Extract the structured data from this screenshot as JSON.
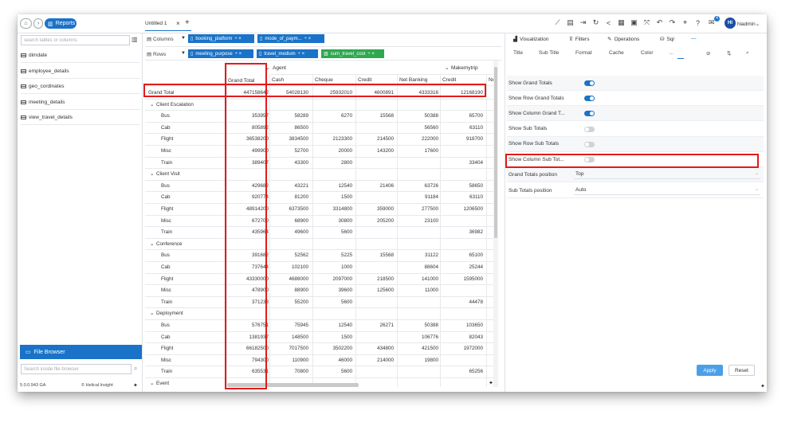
{
  "topbar": {
    "home_icon": "home-icon",
    "reports_label": "Reports",
    "tab_label": "Untitled 1",
    "tab_close": "×",
    "tab_add": "+",
    "bell_count": "4",
    "avatar": "HI",
    "user": "hiadmin"
  },
  "left": {
    "search_placeholder": "search tables or columns",
    "tables": [
      "dimdate",
      "employee_details",
      "geo_cordinates",
      "meeting_details",
      "view_travel_details"
    ],
    "file_browser": "File Browser",
    "file_search_placeholder": "Search inside file browser",
    "version": "5.0.0.943 GA",
    "brand": "Helical Insight"
  },
  "zones": {
    "columns_label": "Columns",
    "rows_label": "Rows",
    "columns": [
      "booking_platform",
      "mode_of_paym..."
    ],
    "rows": [
      "meeting_purpose",
      "travel_medium"
    ],
    "measure": "sum_travel_cost"
  },
  "pivot": {
    "group1": "Agent",
    "group2": "Makemytrip",
    "grand_total_header": "Grand Total",
    "columns": [
      "Cash",
      "Cheque",
      "Credit",
      "Net Banking",
      "Credit",
      "Ne"
    ],
    "grand_total_row": {
      "label": "Grand Total",
      "total": "447158642",
      "values": [
        "54028130",
        "25932010",
        "4600891",
        "4333316",
        "12168190",
        ""
      ]
    },
    "groups": [
      {
        "name": "Client Escalation",
        "rows": [
          {
            "label": "Bus",
            "total": "353957",
            "values": [
              "58289",
              "6270",
              "15568",
              "50388",
              "65700",
              ""
            ]
          },
          {
            "label": "Cab",
            "total": "805892",
            "values": [
              "86500",
              "",
              "",
              "56560",
              "63110",
              ""
            ]
          },
          {
            "label": "Flight",
            "total": "36538200",
            "values": [
              "3834500",
              "2123300",
              "214500",
              "222000",
              "918700",
              ""
            ]
          },
          {
            "label": "Misc",
            "total": "499900",
            "values": [
              "52700",
              "20000",
              "143200",
              "17600",
              "",
              ""
            ]
          },
          {
            "label": "Train",
            "total": "389407",
            "values": [
              "43300",
              "2800",
              "",
              "",
              "33404",
              ""
            ]
          }
        ]
      },
      {
        "name": "Client Visit",
        "rows": [
          {
            "label": "Bus",
            "total": "429682",
            "values": [
              "43221",
              "12540",
              "21406",
              "63726",
              "58650",
              ""
            ]
          },
          {
            "label": "Cab",
            "total": "920774",
            "values": [
              "81200",
              "1500",
              "",
              "91184",
              "63110",
              ""
            ]
          },
          {
            "label": "Flight",
            "total": "48914200",
            "values": [
              "6373500",
              "3314800",
              "359000",
              "277500",
              "1206500",
              ""
            ]
          },
          {
            "label": "Misc",
            "total": "672700",
            "values": [
              "68900",
              "30800",
              "205200",
              "23100",
              "",
              ""
            ]
          },
          {
            "label": "Train",
            "total": "435964",
            "values": [
              "49600",
              "5600",
              "",
              "",
              "36982",
              ""
            ]
          }
        ]
      },
      {
        "name": "Conference",
        "rows": [
          {
            "label": "Bus",
            "total": "391682",
            "values": [
              "52562",
              "5225",
              "15568",
              "31122",
              "65100",
              ""
            ]
          },
          {
            "label": "Cab",
            "total": "737644",
            "values": [
              "102100",
              "1000",
              "",
              "88604",
              "25244",
              ""
            ]
          },
          {
            "label": "Flight",
            "total": "43330000",
            "values": [
              "4688000",
              "2097000",
              "218500",
              "141000",
              "1595000",
              ""
            ]
          },
          {
            "label": "Misc",
            "total": "478900",
            "values": [
              "88900",
              "39600",
              "125600",
              "11000",
              "",
              ""
            ]
          },
          {
            "label": "Train",
            "total": "371233",
            "values": [
              "55200",
              "5600",
              "",
              "",
              "44478",
              ""
            ]
          }
        ]
      },
      {
        "name": "Deployment",
        "rows": [
          {
            "label": "Bus",
            "total": "576751",
            "values": [
              "75945",
              "12540",
              "26271",
              "50388",
              "103650",
              ""
            ]
          },
          {
            "label": "Cab",
            "total": "1381937",
            "values": [
              "148500",
              "1500",
              "",
              "106776",
              "82043",
              ""
            ]
          },
          {
            "label": "Flight",
            "total": "66182500",
            "values": [
              "7017500",
              "3502200",
              "434800",
              "421500",
              "1972000",
              ""
            ]
          },
          {
            "label": "Misc",
            "total": "794300",
            "values": [
              "110900",
              "46000",
              "214000",
              "19800",
              "",
              ""
            ]
          },
          {
            "label": "Train",
            "total": "635531",
            "values": [
              "70800",
              "5600",
              "",
              "",
              "65256",
              ""
            ]
          }
        ]
      },
      {
        "name": "Event",
        "rows": []
      }
    ]
  },
  "right": {
    "tabs": [
      "Visualization",
      "Filters",
      "Operations",
      "Sql",
      "—"
    ],
    "subtabs": [
      "Title",
      "Sub Title",
      "Format",
      "Cache",
      "Color",
      "..."
    ],
    "toggles": [
      {
        "label": "Show Grand Totals",
        "on": true
      },
      {
        "label": "Show Row Grand Totals",
        "on": true
      },
      {
        "label": "Show Column Grand T...",
        "on": true
      },
      {
        "label": "Show Sub Totals",
        "on": false
      },
      {
        "label": "Show Row Sub Totals",
        "on": false
      },
      {
        "label": "Show Column Sub Tot...",
        "on": false
      }
    ],
    "grand_pos_label": "Grand Totals position",
    "grand_pos_value": "Top",
    "sub_pos_label": "Sub Totals position",
    "sub_pos_value": "Auto",
    "apply": "Apply",
    "reset": "Reset"
  }
}
